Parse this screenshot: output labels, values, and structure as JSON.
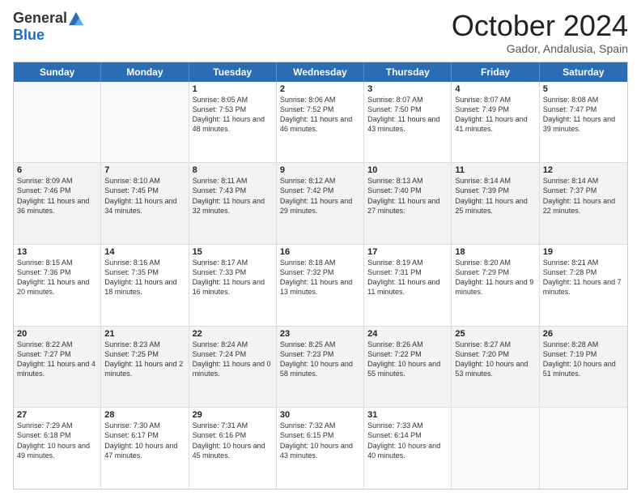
{
  "logo": {
    "general": "General",
    "blue": "Blue"
  },
  "header": {
    "month": "October 2024",
    "location": "Gador, Andalusia, Spain"
  },
  "days": [
    "Sunday",
    "Monday",
    "Tuesday",
    "Wednesday",
    "Thursday",
    "Friday",
    "Saturday"
  ],
  "weeks": [
    [
      {
        "day": "",
        "sunrise": "",
        "sunset": "",
        "daylight": "",
        "empty": true
      },
      {
        "day": "",
        "sunrise": "",
        "sunset": "",
        "daylight": "",
        "empty": true
      },
      {
        "day": "1",
        "sunrise": "Sunrise: 8:05 AM",
        "sunset": "Sunset: 7:53 PM",
        "daylight": "Daylight: 11 hours and 48 minutes."
      },
      {
        "day": "2",
        "sunrise": "Sunrise: 8:06 AM",
        "sunset": "Sunset: 7:52 PM",
        "daylight": "Daylight: 11 hours and 46 minutes."
      },
      {
        "day": "3",
        "sunrise": "Sunrise: 8:07 AM",
        "sunset": "Sunset: 7:50 PM",
        "daylight": "Daylight: 11 hours and 43 minutes."
      },
      {
        "day": "4",
        "sunrise": "Sunrise: 8:07 AM",
        "sunset": "Sunset: 7:49 PM",
        "daylight": "Daylight: 11 hours and 41 minutes."
      },
      {
        "day": "5",
        "sunrise": "Sunrise: 8:08 AM",
        "sunset": "Sunset: 7:47 PM",
        "daylight": "Daylight: 11 hours and 39 minutes."
      }
    ],
    [
      {
        "day": "6",
        "sunrise": "Sunrise: 8:09 AM",
        "sunset": "Sunset: 7:46 PM",
        "daylight": "Daylight: 11 hours and 36 minutes."
      },
      {
        "day": "7",
        "sunrise": "Sunrise: 8:10 AM",
        "sunset": "Sunset: 7:45 PM",
        "daylight": "Daylight: 11 hours and 34 minutes."
      },
      {
        "day": "8",
        "sunrise": "Sunrise: 8:11 AM",
        "sunset": "Sunset: 7:43 PM",
        "daylight": "Daylight: 11 hours and 32 minutes."
      },
      {
        "day": "9",
        "sunrise": "Sunrise: 8:12 AM",
        "sunset": "Sunset: 7:42 PM",
        "daylight": "Daylight: 11 hours and 29 minutes."
      },
      {
        "day": "10",
        "sunrise": "Sunrise: 8:13 AM",
        "sunset": "Sunset: 7:40 PM",
        "daylight": "Daylight: 11 hours and 27 minutes."
      },
      {
        "day": "11",
        "sunrise": "Sunrise: 8:14 AM",
        "sunset": "Sunset: 7:39 PM",
        "daylight": "Daylight: 11 hours and 25 minutes."
      },
      {
        "day": "12",
        "sunrise": "Sunrise: 8:14 AM",
        "sunset": "Sunset: 7:37 PM",
        "daylight": "Daylight: 11 hours and 22 minutes."
      }
    ],
    [
      {
        "day": "13",
        "sunrise": "Sunrise: 8:15 AM",
        "sunset": "Sunset: 7:36 PM",
        "daylight": "Daylight: 11 hours and 20 minutes."
      },
      {
        "day": "14",
        "sunrise": "Sunrise: 8:16 AM",
        "sunset": "Sunset: 7:35 PM",
        "daylight": "Daylight: 11 hours and 18 minutes."
      },
      {
        "day": "15",
        "sunrise": "Sunrise: 8:17 AM",
        "sunset": "Sunset: 7:33 PM",
        "daylight": "Daylight: 11 hours and 16 minutes."
      },
      {
        "day": "16",
        "sunrise": "Sunrise: 8:18 AM",
        "sunset": "Sunset: 7:32 PM",
        "daylight": "Daylight: 11 hours and 13 minutes."
      },
      {
        "day": "17",
        "sunrise": "Sunrise: 8:19 AM",
        "sunset": "Sunset: 7:31 PM",
        "daylight": "Daylight: 11 hours and 11 minutes."
      },
      {
        "day": "18",
        "sunrise": "Sunrise: 8:20 AM",
        "sunset": "Sunset: 7:29 PM",
        "daylight": "Daylight: 11 hours and 9 minutes."
      },
      {
        "day": "19",
        "sunrise": "Sunrise: 8:21 AM",
        "sunset": "Sunset: 7:28 PM",
        "daylight": "Daylight: 11 hours and 7 minutes."
      }
    ],
    [
      {
        "day": "20",
        "sunrise": "Sunrise: 8:22 AM",
        "sunset": "Sunset: 7:27 PM",
        "daylight": "Daylight: 11 hours and 4 minutes."
      },
      {
        "day": "21",
        "sunrise": "Sunrise: 8:23 AM",
        "sunset": "Sunset: 7:25 PM",
        "daylight": "Daylight: 11 hours and 2 minutes."
      },
      {
        "day": "22",
        "sunrise": "Sunrise: 8:24 AM",
        "sunset": "Sunset: 7:24 PM",
        "daylight": "Daylight: 11 hours and 0 minutes."
      },
      {
        "day": "23",
        "sunrise": "Sunrise: 8:25 AM",
        "sunset": "Sunset: 7:23 PM",
        "daylight": "Daylight: 10 hours and 58 minutes."
      },
      {
        "day": "24",
        "sunrise": "Sunrise: 8:26 AM",
        "sunset": "Sunset: 7:22 PM",
        "daylight": "Daylight: 10 hours and 55 minutes."
      },
      {
        "day": "25",
        "sunrise": "Sunrise: 8:27 AM",
        "sunset": "Sunset: 7:20 PM",
        "daylight": "Daylight: 10 hours and 53 minutes."
      },
      {
        "day": "26",
        "sunrise": "Sunrise: 8:28 AM",
        "sunset": "Sunset: 7:19 PM",
        "daylight": "Daylight: 10 hours and 51 minutes."
      }
    ],
    [
      {
        "day": "27",
        "sunrise": "Sunrise: 7:29 AM",
        "sunset": "Sunset: 6:18 PM",
        "daylight": "Daylight: 10 hours and 49 minutes."
      },
      {
        "day": "28",
        "sunrise": "Sunrise: 7:30 AM",
        "sunset": "Sunset: 6:17 PM",
        "daylight": "Daylight: 10 hours and 47 minutes."
      },
      {
        "day": "29",
        "sunrise": "Sunrise: 7:31 AM",
        "sunset": "Sunset: 6:16 PM",
        "daylight": "Daylight: 10 hours and 45 minutes."
      },
      {
        "day": "30",
        "sunrise": "Sunrise: 7:32 AM",
        "sunset": "Sunset: 6:15 PM",
        "daylight": "Daylight: 10 hours and 43 minutes."
      },
      {
        "day": "31",
        "sunrise": "Sunrise: 7:33 AM",
        "sunset": "Sunset: 6:14 PM",
        "daylight": "Daylight: 10 hours and 40 minutes."
      },
      {
        "day": "",
        "sunrise": "",
        "sunset": "",
        "daylight": "",
        "empty": true
      },
      {
        "day": "",
        "sunrise": "",
        "sunset": "",
        "daylight": "",
        "empty": true
      }
    ]
  ]
}
